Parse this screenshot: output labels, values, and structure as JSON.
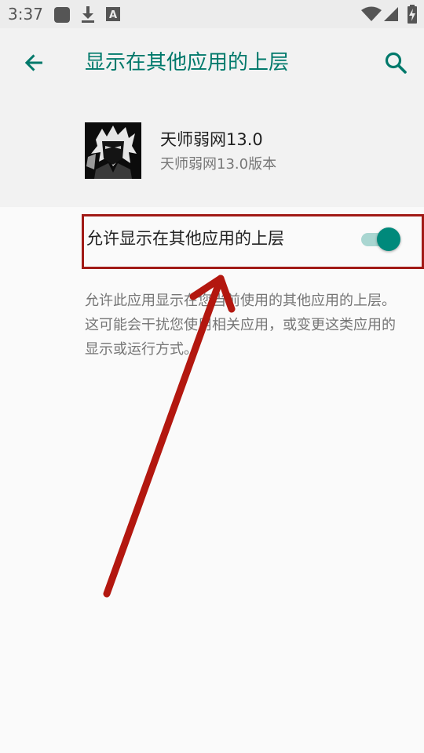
{
  "status_bar": {
    "time": "3:37",
    "icons": [
      "notification-square-icon",
      "download-icon",
      "font-a-icon",
      "wifi-icon",
      "cellular-signal-icon",
      "battery-charging-icon"
    ]
  },
  "header": {
    "title": "显示在其他应用的上层",
    "back_icon": "arrow-back-icon",
    "search_icon": "search-icon",
    "accent_color": "#00796b"
  },
  "app_info": {
    "name": "天师弱网13.0",
    "version": "天师弱网13.0版本"
  },
  "setting": {
    "label": "允许显示在其他应用的上层",
    "enabled": true,
    "toggle_color": "#00897b"
  },
  "description": "允许此应用显示在您当前使用的其他应用的上层。这可能会干扰您使用相关应用，或变更这类应用的显示或运行方式。",
  "annotation": {
    "highlight_color": "#a11a16",
    "arrow_color": "#b3170f"
  }
}
